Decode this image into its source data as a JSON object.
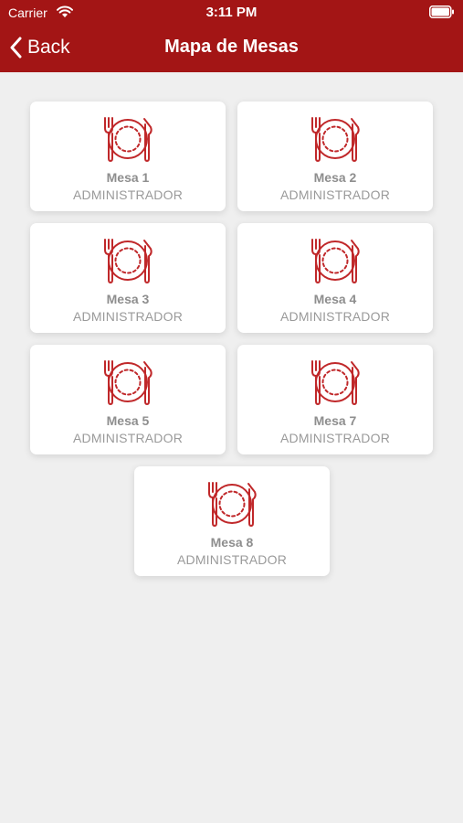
{
  "status_bar": {
    "carrier": "Carrier",
    "time": "3:11 PM"
  },
  "nav": {
    "back_label": "Back",
    "title": "Mapa de Mesas"
  },
  "colors": {
    "brand": "#a31515",
    "icon": "#c0282a",
    "background": "#efefef"
  },
  "tables": [
    {
      "name": "Mesa 1",
      "role": "ADMINISTRADOR",
      "icon": "plate-cutlery-icon"
    },
    {
      "name": "Mesa 2",
      "role": "ADMINISTRADOR",
      "icon": "plate-cutlery-icon"
    },
    {
      "name": "Mesa 3",
      "role": "ADMINISTRADOR",
      "icon": "plate-cutlery-icon"
    },
    {
      "name": "Mesa 4",
      "role": "ADMINISTRADOR",
      "icon": "plate-cutlery-icon"
    },
    {
      "name": "Mesa 5",
      "role": "ADMINISTRADOR",
      "icon": "plate-cutlery-icon"
    },
    {
      "name": "Mesa 7",
      "role": "ADMINISTRADOR",
      "icon": "plate-cutlery-icon"
    },
    {
      "name": "Mesa 8",
      "role": "ADMINISTRADOR",
      "icon": "plate-cutlery-icon"
    }
  ]
}
